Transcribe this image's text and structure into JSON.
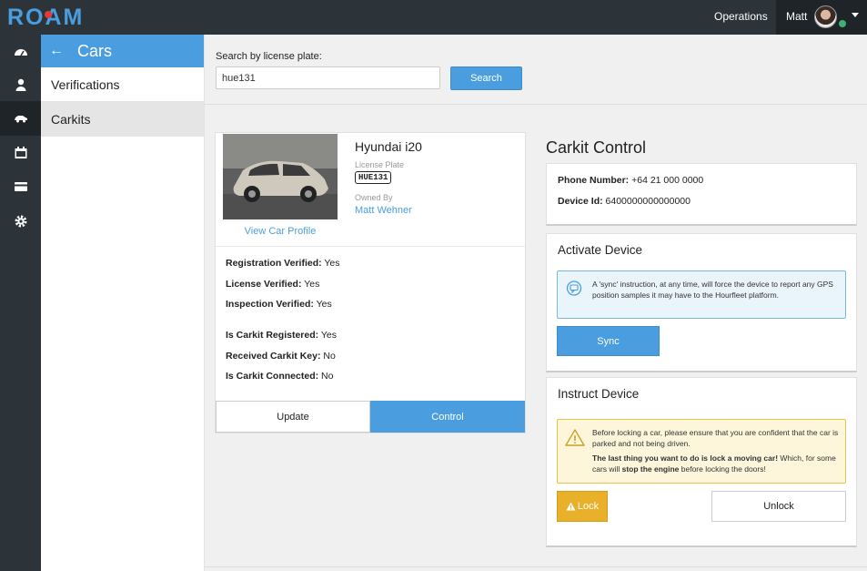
{
  "app": {
    "logo": "ROAM"
  },
  "topbar": {
    "operations": "Operations",
    "user_name": "Matt"
  },
  "rail": {
    "items": [
      {
        "icon": "dashboard-icon"
      },
      {
        "icon": "user-icon"
      },
      {
        "icon": "car-icon",
        "active": true
      },
      {
        "icon": "calendar-icon"
      },
      {
        "icon": "credit-card-icon"
      },
      {
        "icon": "gear-icon"
      }
    ]
  },
  "subnav": {
    "title": "Cars",
    "items": [
      {
        "label": "Verifications"
      },
      {
        "label": "Carkits",
        "active": true
      }
    ]
  },
  "search": {
    "label": "Search by license plate:",
    "value": "hue131",
    "button": "Search"
  },
  "car": {
    "name": "Hyundai i20",
    "plate_label": "License Plate",
    "plate": "HUE131",
    "owned_label": "Owned By",
    "owner": "Matt Wehner",
    "view_profile": "View Car Profile",
    "facts": [
      {
        "label": "Registration Verified:",
        "value": "Yes"
      },
      {
        "label": "License Verified:",
        "value": "Yes"
      },
      {
        "label": "Inspection Verified:",
        "value": "Yes"
      },
      {
        "label": "Is Carkit Registered:",
        "value": "Yes"
      },
      {
        "label": "Received Carkit Key:",
        "value": "No"
      },
      {
        "label": "Is Carkit Connected:",
        "value": "No"
      }
    ],
    "update_button": "Update",
    "control_button": "Control"
  },
  "carkit": {
    "title": "Carkit Control",
    "phone_label": "Phone Number:",
    "phone": "+64 21 000 0000",
    "device_label": "Device Id:",
    "device_id": "6400000000000000",
    "activate_title": "Activate Device",
    "activate_info": "A 'sync' instruction, at any time, will force the device to report any GPS position samples it may have to the Hourfleet platform.",
    "sync_button": "Sync",
    "instruct_title": "Instruct Device",
    "warn_line1": "Before locking a car, please ensure that you are confident that the car is parked and not being driven.",
    "warn_bold1": "The last thing you want to do is lock a moving car!",
    "warn_mid": " Which, for some cars will ",
    "warn_bold2": "stop the engine",
    "warn_end": " before locking the doors!",
    "lock_button": "Lock",
    "unlock_button": "Unlock"
  },
  "colors": {
    "accent": "#4a9ee0",
    "dark": "#2d3439",
    "warning": "#e9b12a"
  }
}
